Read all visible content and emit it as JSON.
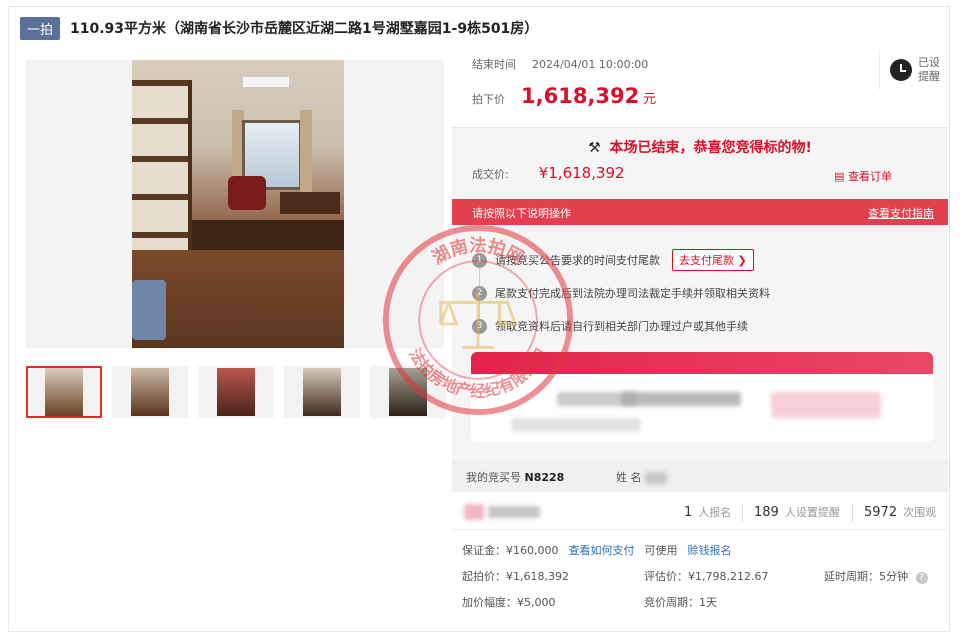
{
  "header": {
    "tag": "一拍",
    "title": "110.93平方米（湖南省长沙市岳麓区近湖二路1号湖墅嘉园1-9栋501房）"
  },
  "auction": {
    "end_label": "结束时间",
    "end_time": "2024/04/01 10:00:00",
    "price_label": "拍下价",
    "price": "1,618,392",
    "unit": "元",
    "remind_line1": "已设",
    "remind_line2": "提醒"
  },
  "result": {
    "headline": "本场已结束，恭喜您竞得标的物!",
    "deal_label": "成交价:",
    "deal_price": "¥1,618,392",
    "view_order": "查看订单"
  },
  "steps": {
    "head_left": "请按照以下说明操作",
    "head_right": "查看支付指南",
    "items": [
      {
        "num": "1",
        "text": "请按竞买公告要求的时间支付尾款",
        "button": "去支付尾款 ❯"
      },
      {
        "num": "2",
        "text": "尾款支付完成后到法院办理司法裁定手续并领取相关资料"
      },
      {
        "num": "3",
        "text": "领取竞资料后请自行到相关部门办理过户或其他手续"
      }
    ]
  },
  "buyer": {
    "bid_label": "我的竞买号",
    "bid_no": "N8228",
    "name_label": "姓 名"
  },
  "stats": {
    "signup_count": "1",
    "signup_label": "人报名",
    "remind_count": "189",
    "remind_label": "人设置提醒",
    "watch_count": "5972",
    "watch_label": "次围观"
  },
  "details": {
    "deposit": "保证金：¥160,000",
    "how_to_pay": "查看如何支付",
    "can_use": "可使用",
    "credit_signup": "赊钱报名",
    "start_price": "起拍价：¥1,618,392",
    "appraisal": "评估价：¥1,798,212.67",
    "delay": "延时周期：5分钟",
    "increment": "加价幅度：¥5,000",
    "bid_cycle": "竞价周期：1天"
  },
  "seal": {
    "top_text": "湖南法拍网",
    "bottom_text": "法拍房地产经纪有限公司",
    "color": "#e0353b"
  },
  "colors": {
    "accent": "#d6112b",
    "banner": "#e2404f",
    "tag": "#5a6f99"
  }
}
